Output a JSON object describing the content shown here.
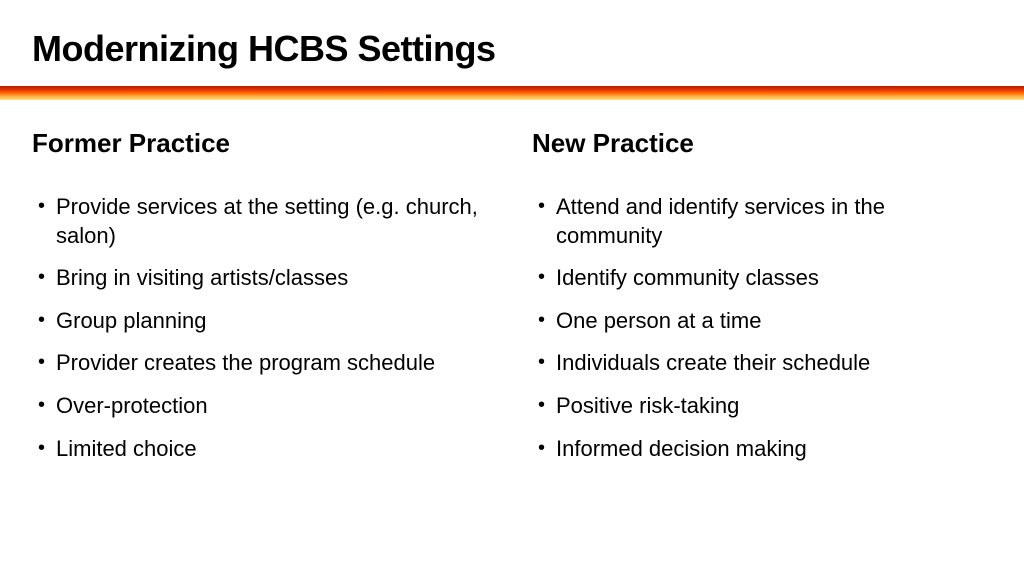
{
  "title": "Modernizing HCBS Settings",
  "left": {
    "heading": "Former Practice",
    "items": [
      "Provide services at the setting (e.g. church, salon)",
      "Bring in visiting artists/classes",
      "Group planning",
      "Provider creates the program schedule",
      "Over-protection",
      "Limited choice"
    ]
  },
  "right": {
    "heading": "New Practice",
    "items": [
      "Attend and identify services in the community",
      "Identify community classes",
      "One person at a time",
      "Individuals create their schedule",
      "Positive risk-taking",
      "Informed decision making"
    ]
  }
}
